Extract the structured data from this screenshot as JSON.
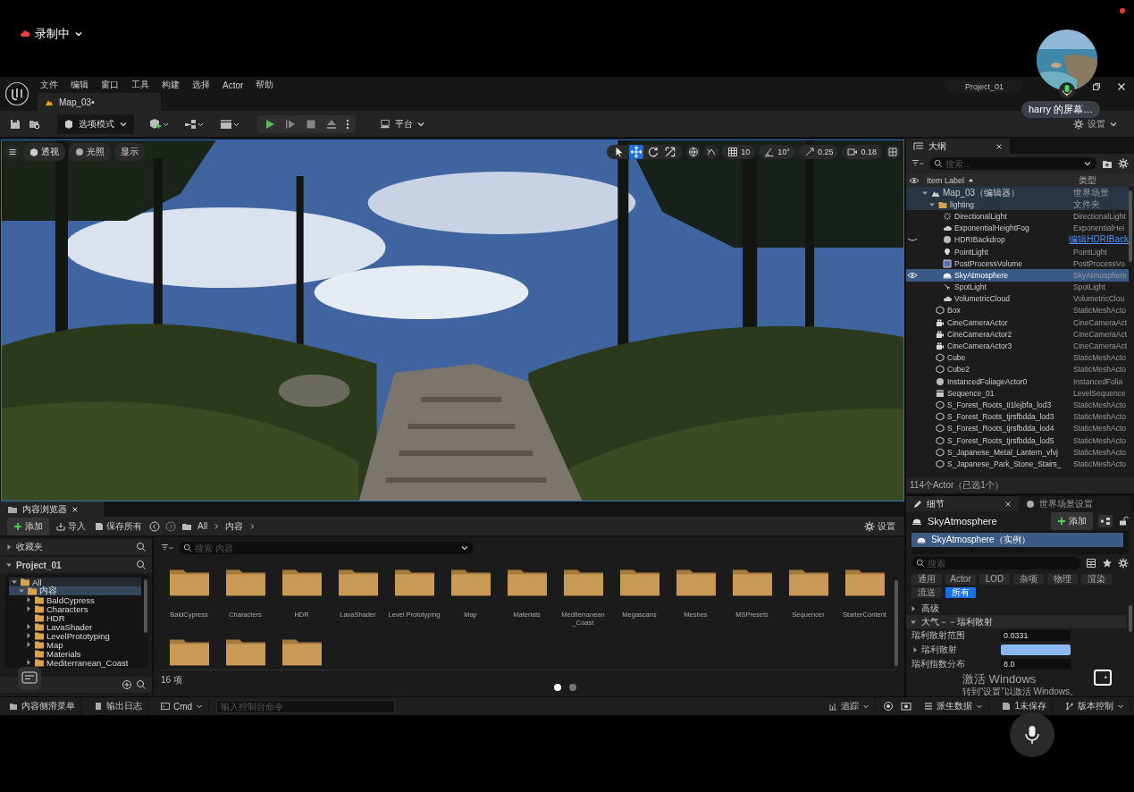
{
  "recording": {
    "label": "录制中"
  },
  "call_overlay": {
    "presenter": "harry 的屏幕…"
  },
  "pager": [
    {
      "selected": true
    },
    {
      "selected": false
    }
  ],
  "os_watermark": {
    "title": "激活 Windows",
    "hint": "转到“设置”以激活 Windows。"
  },
  "menu": [
    "文件",
    "编辑",
    "窗口",
    "工具",
    "构建",
    "选择",
    "Actor",
    "帮助"
  ],
  "project": "Project_01",
  "doc_tab": {
    "label": "Map_03•"
  },
  "toolbar": {
    "mode": "选项模式",
    "platform": "平台",
    "settings": "设置"
  },
  "viewport": {
    "left_buttons": [
      "透视",
      "光照",
      "显示"
    ],
    "tools": [
      {
        "kind": "select",
        "selected": false
      },
      {
        "kind": "move",
        "selected": true
      },
      {
        "kind": "rotate",
        "selected": false
      },
      {
        "kind": "scale",
        "selected": false
      }
    ],
    "grid": "10",
    "angle": "10°",
    "scale": "0.25",
    "camera_speed": "0.18"
  },
  "outliner": {
    "title": "大纲",
    "search_placeholder": "搜索...",
    "col_label": "Item Label",
    "col_type": "类型",
    "rows": [
      {
        "label": "Map_03（编辑器）",
        "type": "世界场景",
        "kind": "map",
        "selected": false,
        "expanded": true,
        "children": [
          {
            "label": "lighting",
            "type": "文件夹",
            "kind": "folder",
            "selected": false,
            "expanded": true,
            "children": [
              {
                "label": "DirectionalLight",
                "type": "DirectionalLight",
                "kind": "sun",
                "selected": false
              },
              {
                "label": "ExponentialHeightFog",
                "type": "ExponentialHei",
                "kind": "fog",
                "selected": false
              },
              {
                "label": "HDRIBackdrop",
                "type": "编辑HDRIBack",
                "type_link": true,
                "kind": "sphere",
                "selected": false,
                "visible": false
              },
              {
                "label": "PointLight",
                "type": "PointLight",
                "kind": "bulb",
                "selected": false
              },
              {
                "label": "PostProcessVolume",
                "type": "PostProcessVo",
                "kind": "volume",
                "selected": false
              },
              {
                "label": "SkyAtmosphere",
                "type": "SkyAtmosphere",
                "kind": "sky",
                "selected": true,
                "visible": true
              },
              {
                "label": "SpotLight",
                "type": "SpotLight",
                "kind": "spot",
                "selected": false
              },
              {
                "label": "VolumetricCloud",
                "type": "VolumetricClou",
                "kind": "cloud",
                "selected": false
              }
            ]
          },
          {
            "label": "Box",
            "type": "StaticMeshActo",
            "kind": "mesh",
            "selected": false
          },
          {
            "label": "CineCameraActor",
            "type": "CineCameraAct",
            "kind": "camera",
            "selected": false
          },
          {
            "label": "CineCameraActor2",
            "type": "CineCameraAct",
            "kind": "camera",
            "selected": false
          },
          {
            "label": "CineCameraActor3",
            "type": "CineCameraAct",
            "kind": "camera",
            "selected": false
          },
          {
            "label": "Cube",
            "type": "StaticMeshActo",
            "kind": "mesh",
            "selected": false
          },
          {
            "label": "Cube2",
            "type": "StaticMeshActo",
            "kind": "mesh",
            "selected": false
          },
          {
            "label": "InstancedFoliageActor0",
            "type": "InstancedFolia",
            "kind": "sphere",
            "selected": false
          },
          {
            "label": "Sequence_01",
            "type": "LevelSequence",
            "kind": "clapper",
            "selected": false
          },
          {
            "label": "S_Forest_Roots_ti1lejbfa_lod3",
            "type": "StaticMeshActo",
            "kind": "mesh",
            "selected": false
          },
          {
            "label": "S_Forest_Roots_tjrsfbdda_lod3",
            "type": "StaticMeshActo",
            "kind": "mesh",
            "selected": false
          },
          {
            "label": "S_Forest_Roots_tjrsfbdda_lod4",
            "type": "StaticMeshActo",
            "kind": "mesh",
            "selected": false
          },
          {
            "label": "S_Forest_Roots_tjrsfbdda_lod5",
            "type": "StaticMeshActo",
            "kind": "mesh",
            "selected": false
          },
          {
            "label": "S_Japanese_Metal_Lantern_vfvj",
            "type": "StaticMeshActo",
            "kind": "mesh",
            "selected": false
          },
          {
            "label": "S_Japanese_Park_Stone_Stairs_",
            "type": "StaticMeshActo",
            "kind": "mesh",
            "selected": false
          }
        ]
      }
    ],
    "footer": "114个Actor（已选1个）"
  },
  "details": {
    "tabs": [
      {
        "label": "细节",
        "selected": true
      },
      {
        "label": "世界场景设置",
        "selected": false
      }
    ],
    "object": "SkyAtmosphere",
    "add": "添加",
    "component": "SkyAtmosphere（实例）",
    "search_placeholder": "搜索",
    "chips": [
      {
        "label": "通用",
        "selected": false
      },
      {
        "label": "Actor",
        "selected": false
      },
      {
        "label": "LOD",
        "selected": false
      },
      {
        "label": "杂项",
        "selected": false
      },
      {
        "label": "物理",
        "selected": false
      },
      {
        "label": "渲染",
        "selected": false
      },
      {
        "label": "流送",
        "selected": false
      },
      {
        "label": "所有",
        "selected": true
      }
    ],
    "sections": [
      {
        "label": "高级",
        "expanded": false
      },
      {
        "label": "大气－－瑞利散射",
        "expanded": true
      }
    ],
    "properties": [
      {
        "kind": "number",
        "label": "瑞利散射范围",
        "value": "0.0331"
      },
      {
        "kind": "color",
        "label": "瑞利散射",
        "color": "#8ab8f0"
      },
      {
        "kind": "number",
        "label": "瑞利指数分布",
        "value": "8.0"
      }
    ]
  },
  "content_browser": {
    "title": "内容浏览器",
    "add": "添加",
    "import": "导入",
    "save_all": "保存所有",
    "path": [
      "All",
      "内容"
    ],
    "settings": "设置",
    "favorites": "收藏夹",
    "project": "Project_01",
    "tree": [
      {
        "label": "All",
        "selected": false,
        "expandable": true,
        "expanded": true,
        "children": [
          {
            "label": "内容",
            "selected": true,
            "expandable": true,
            "expanded": true,
            "children": [
              {
                "label": "BaldCypress",
                "selected": false,
                "expandable": true,
                "expanded": false
              },
              {
                "label": "Characters",
                "selected": false,
                "expandable": true,
                "expanded": false
              },
              {
                "label": "HDR",
                "selected": false,
                "expandable": false,
                "expanded": false
              },
              {
                "label": "LavaShader",
                "selected": false,
                "expandable": true,
                "expanded": false
              },
              {
                "label": "LevelPrototyping",
                "selected": false,
                "expandable": true,
                "expanded": false
              },
              {
                "label": "Map",
                "selected": false,
                "expandable": true,
                "expanded": false
              },
              {
                "label": "Materials",
                "selected": false,
                "expandable": false,
                "expanded": false
              },
              {
                "label": "Mediterranean_Coast",
                "selected": false,
                "expandable": true,
                "expanded": false
              }
            ]
          }
        ]
      }
    ],
    "search_placeholder": "搜索 内容",
    "folders": [
      {
        "kind": "folder",
        "label": "BaldCypress"
      },
      {
        "kind": "folder",
        "label": "Characters"
      },
      {
        "kind": "folder",
        "label": "HDR"
      },
      {
        "kind": "folder",
        "label": "LavaShader"
      },
      {
        "kind": "folder",
        "label": "Level Prototyping"
      },
      {
        "kind": "folder",
        "label": "Map"
      },
      {
        "kind": "folder",
        "label": "Materials"
      },
      {
        "kind": "folder",
        "label": "Mediterranean _Coast"
      },
      {
        "kind": "folder",
        "label": "Megascans"
      },
      {
        "kind": "folder",
        "label": "Meshes"
      },
      {
        "kind": "folder",
        "label": "MSPresets"
      },
      {
        "kind": "folder",
        "label": "Sequencer"
      },
      {
        "kind": "folder",
        "label": "StarterContent"
      },
      {
        "kind": "folder"
      },
      {
        "kind": "folder"
      },
      {
        "kind": "folder"
      }
    ],
    "count": "16 项"
  },
  "status_bar": {
    "drawer": "内容侧滑菜单",
    "output_log": "输出日志",
    "cmd": "Cmd",
    "cmd_placeholder": "输入控制台命令",
    "trace": "追踪",
    "derived_data": "派生数据",
    "unsaved": "1未保存",
    "source_control": "版本控制"
  }
}
